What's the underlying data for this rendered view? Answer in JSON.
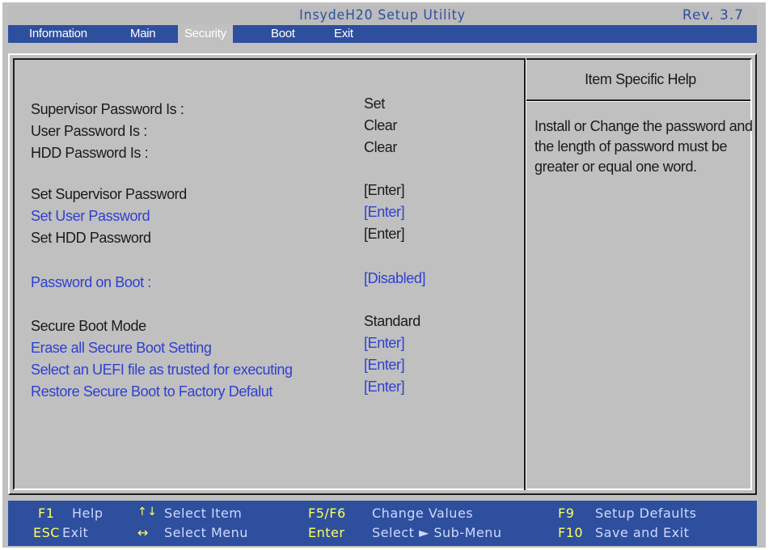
{
  "header": {
    "title": "InsydeH20 Setup Utility",
    "revision": "Rev. 3.7"
  },
  "menu": {
    "tabs": [
      {
        "label": "Information",
        "active": false
      },
      {
        "label": "Main",
        "active": false
      },
      {
        "label": "Security",
        "active": true
      },
      {
        "label": "Boot",
        "active": false
      },
      {
        "label": "Exit",
        "active": false
      }
    ]
  },
  "settings": {
    "status": [
      {
        "label": "Supervisor Password Is :",
        "value": "Set"
      },
      {
        "label": "User Password Is :",
        "value": "Clear"
      },
      {
        "label": "HDD Password Is :",
        "value": "Clear"
      }
    ],
    "passwords": [
      {
        "label": "Set Supervisor Password",
        "value": "[Enter]",
        "selectable": false
      },
      {
        "label": "Set User Password",
        "value": "[Enter]",
        "selectable": true
      },
      {
        "label": "Set HDD Password",
        "value": "[Enter]",
        "selectable": false
      }
    ],
    "boot_password": {
      "label": "Password on Boot :",
      "value": "[Disabled]",
      "selectable": true
    },
    "secure_boot": [
      {
        "label": "Secure Boot Mode",
        "value": "Standard",
        "selectable": false
      },
      {
        "label": "Erase all Secure Boot Setting",
        "value": "[Enter]",
        "selectable": true
      },
      {
        "label": "Select an UEFI file as trusted for executing",
        "value": "[Enter]",
        "selectable": true
      },
      {
        "label": "Restore Secure Boot to Factory Defalut",
        "value": "[Enter]",
        "selectable": true
      }
    ]
  },
  "help": {
    "title": "Item Specific Help",
    "text": "Install or Change the password and the length of password must be greater or equal one word."
  },
  "footer": {
    "keys": [
      {
        "key": "F1",
        "desc": "Help"
      },
      {
        "key": "ESC",
        "desc": "Exit"
      },
      {
        "key": "↑↓",
        "desc": "Select  Item"
      },
      {
        "key": "↔",
        "desc": "Select  Menu"
      },
      {
        "key": "F5/F6",
        "desc": "Change  Values"
      },
      {
        "key": "Enter",
        "desc": "Select  ► Sub-Menu"
      },
      {
        "key": "F9",
        "desc": "Setup  Defaults"
      },
      {
        "key": "F10",
        "desc": "Save  and  Exit"
      }
    ]
  },
  "colors": {
    "accent_blue": "#2e4f9e",
    "background_gray": "#c0c0c0",
    "selectable_text": "#2f3fcf",
    "hotkey_yellow": "#ffff5a"
  }
}
